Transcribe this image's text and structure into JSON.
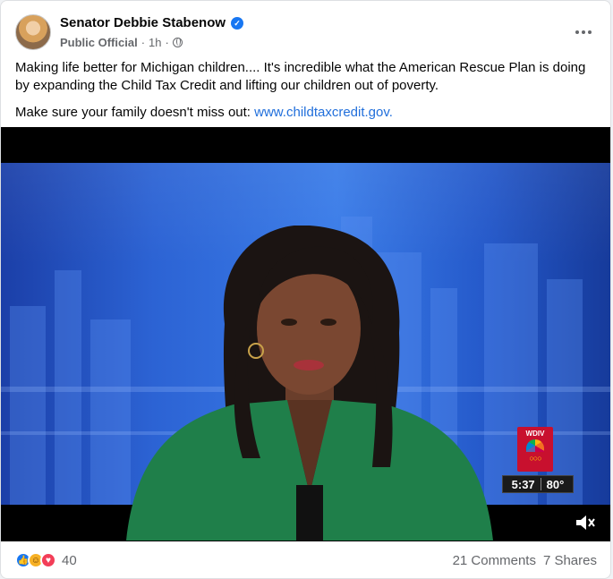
{
  "post": {
    "author": "Senator Debbie Stabenow",
    "category": "Public Official",
    "time": "1h",
    "separator": "·",
    "verified_icon": "verified-badge-icon",
    "audience_icon": "globe-icon",
    "text_line_1": "Making life better for Michigan children.... It's incredible what the American Rescue Plan is doing by expanding the Child Tax Credit and lifting our children out of poverty.",
    "text_line_2_prefix": "Make sure your family doesn't miss out: ",
    "link_text": "www.childtaxcredit.gov.",
    "link_color": "#216fdb"
  },
  "video": {
    "station": "WDIV",
    "time": "5:37",
    "temperature": "80°",
    "mute_icon": "speaker-muted-icon"
  },
  "footer": {
    "reaction_icons": [
      "like-icon",
      "haha-icon",
      "love-icon"
    ],
    "reaction_count": "40",
    "comments": "21 Comments",
    "shares": "7 Shares"
  },
  "colors": {
    "accent": "#1877f2",
    "secondary_text": "#65676b"
  }
}
